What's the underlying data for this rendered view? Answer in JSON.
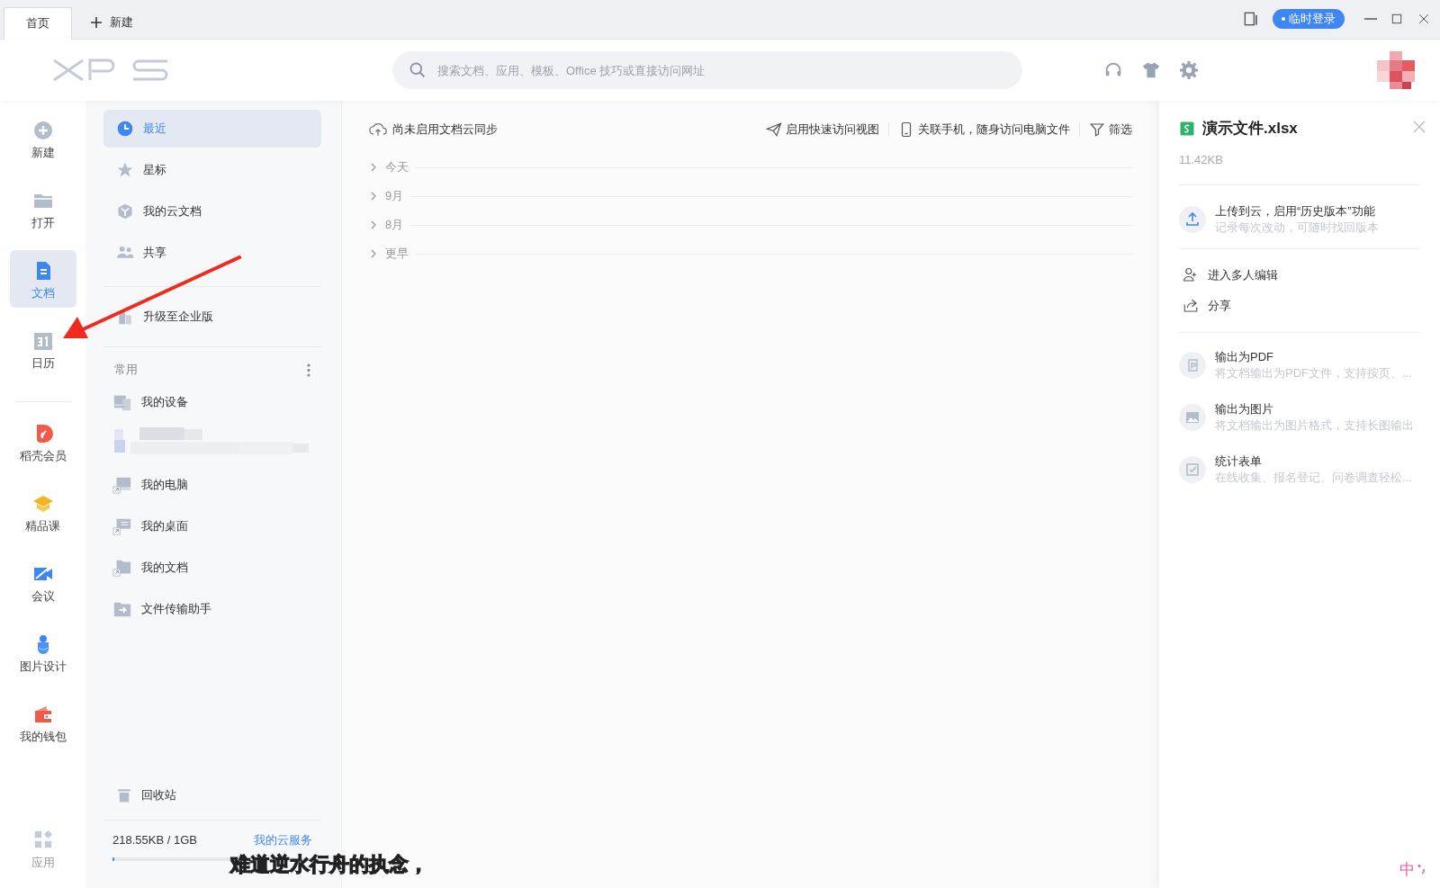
{
  "tabs": [
    {
      "label": "首页",
      "selected": true
    },
    {
      "label": "新建",
      "selected": false
    }
  ],
  "login_badge": "临时登录",
  "search": {
    "placeholder": "搜索文档、应用、模板、Office 技巧或直接访问网址"
  },
  "rail": {
    "items": [
      {
        "label": "新建",
        "selected": false
      },
      {
        "label": "打开",
        "selected": false
      },
      {
        "label": "文档",
        "selected": true
      },
      {
        "label": "日历",
        "selected": false
      },
      {
        "label": "稻壳会员",
        "selected": false
      },
      {
        "label": "精品课",
        "selected": false
      },
      {
        "label": "会议",
        "selected": false
      },
      {
        "label": "图片设计",
        "selected": false
      },
      {
        "label": "我的钱包",
        "selected": false
      }
    ],
    "apps": "应用"
  },
  "nav": {
    "items": [
      {
        "label": "最近",
        "selected": true
      },
      {
        "label": "星标",
        "selected": false
      },
      {
        "label": "我的云文档",
        "selected": false
      },
      {
        "label": "共享",
        "selected": false
      }
    ],
    "upgrade": "升级至企业版",
    "section": "常用",
    "common": [
      {
        "label": "我的设备"
      },
      {
        "kind": "picture"
      },
      {
        "label": "我的电脑"
      },
      {
        "label": "我的桌面"
      },
      {
        "label": "我的文档"
      },
      {
        "label": "文件传输助手"
      }
    ],
    "trash": "回收站",
    "storage": {
      "text": "218.55KB / 1GB",
      "level": 0.01
    },
    "cloud_link": "我的云服务"
  },
  "main": {
    "sync": "尚未启用文档云同步",
    "actions": [
      "启用快速访问视图",
      "关联手机，随身访问电脑文件",
      "筛选"
    ],
    "groups": [
      {
        "label": "今天",
        "expanded": false
      },
      {
        "label": "9月",
        "expanded": false
      },
      {
        "label": "8月",
        "expanded": false
      },
      {
        "label": "更早",
        "expanded": false
      }
    ]
  },
  "detail": {
    "file_name": "演示文件.xlsx",
    "size": "11.42KB",
    "upload": {
      "title": "上传到云，启用“历史版本”功能",
      "subtitle": "记录每次改动，可随时找回版本"
    },
    "links": [
      "进入多人编辑",
      "分享"
    ],
    "exports": [
      {
        "title": "输出为PDF",
        "subtitle": "将文档输出为PDF文件，支持按页、..."
      },
      {
        "title": "输出为图片",
        "subtitle": "将文档输出为图片格式，支持长图输出"
      },
      {
        "title": "统计表单",
        "subtitle": "在线收集、报名登记、问卷调查轻松..."
      }
    ]
  },
  "subtitle": "难道逆水行舟的执念，",
  "ime": "中"
}
